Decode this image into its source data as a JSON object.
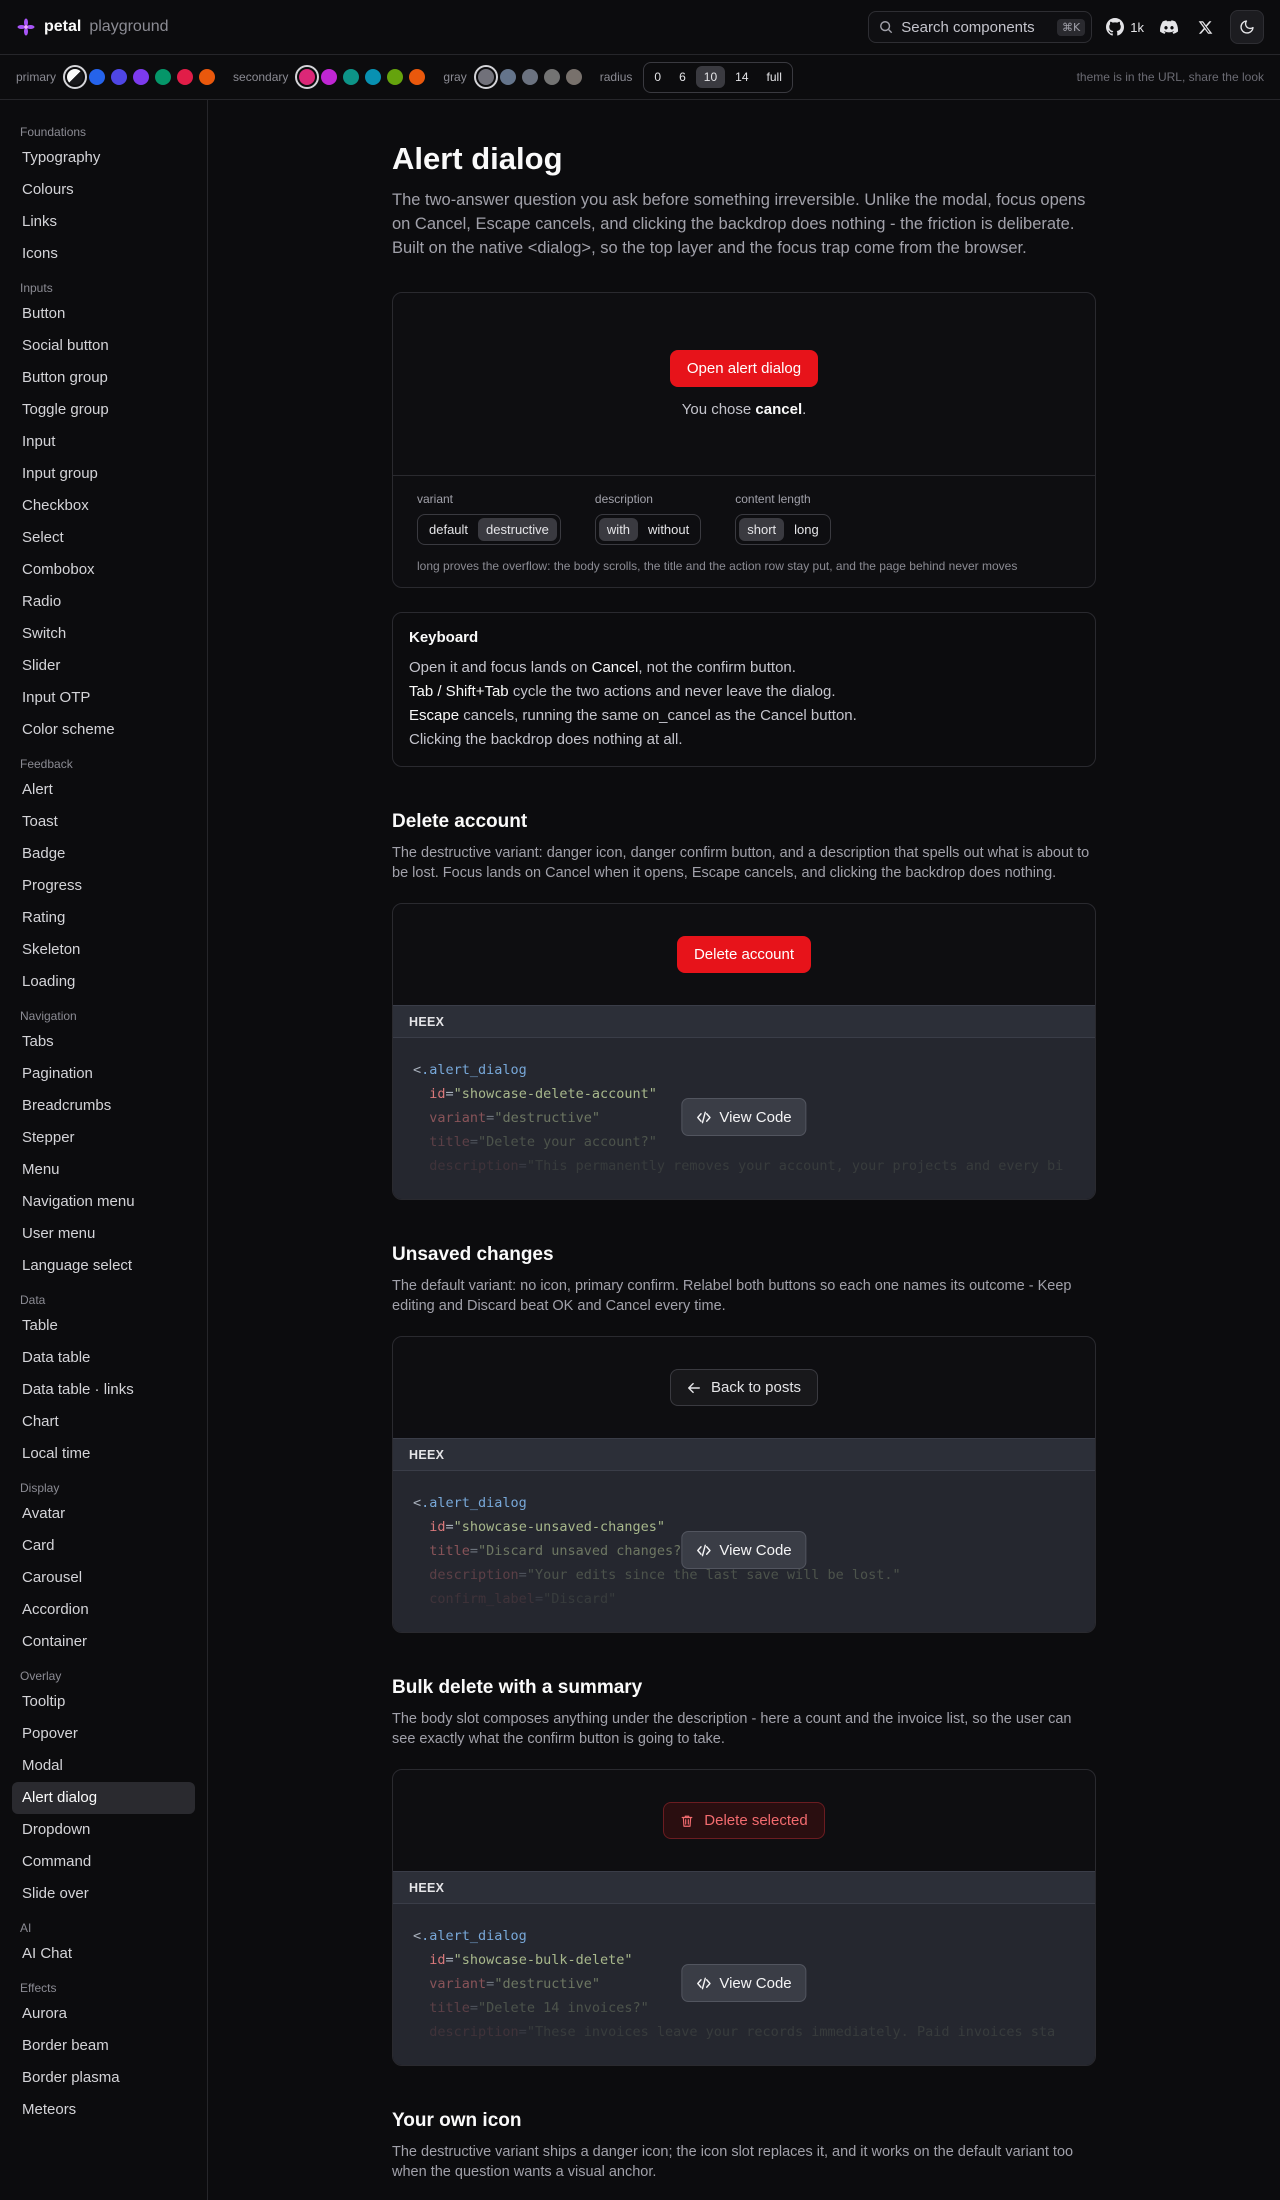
{
  "header": {
    "brand": "petal",
    "brand_sub": "playground",
    "search_placeholder": "Search components",
    "search_shortcut": "⌘K",
    "github_count": "1k"
  },
  "themebar": {
    "primary_label": "primary",
    "secondary_label": "secondary",
    "gray_label": "gray",
    "radius_label": "radius",
    "primary_colors": [
      "#e4e4e7",
      "#2563eb",
      "#4f46e5",
      "#7c3aed",
      "#059669",
      "#e11d48",
      "#ea580c"
    ],
    "secondary_colors": [
      "#db2777",
      "#c026d3",
      "#0d9488",
      "#0891b2",
      "#65a30d",
      "#ea580c"
    ],
    "gray_colors": [
      "#71717a",
      "#64748b",
      "#6b7280",
      "#737373",
      "#78716c"
    ],
    "radius_options": [
      "0",
      "6",
      "10",
      "14",
      "full"
    ],
    "radius_selected": "10",
    "note": "theme is in the URL, share the look"
  },
  "sidebar": {
    "sections": [
      {
        "title": "Foundations",
        "items": [
          "Typography",
          "Colours",
          "Links",
          "Icons"
        ]
      },
      {
        "title": "Inputs",
        "items": [
          "Button",
          "Social button",
          "Button group",
          "Toggle group",
          "Input",
          "Input group",
          "Checkbox",
          "Select",
          "Combobox",
          "Radio",
          "Switch",
          "Slider",
          "Input OTP",
          "Color scheme"
        ]
      },
      {
        "title": "Feedback",
        "items": [
          "Alert",
          "Toast",
          "Badge",
          "Progress",
          "Rating",
          "Skeleton",
          "Loading"
        ]
      },
      {
        "title": "Navigation",
        "items": [
          "Tabs",
          "Pagination",
          "Breadcrumbs",
          "Stepper",
          "Menu",
          "Navigation menu",
          "User menu",
          "Language select"
        ]
      },
      {
        "title": "Data",
        "items": [
          "Table",
          "Data table",
          "Data table · links",
          "Chart",
          "Local time"
        ]
      },
      {
        "title": "Display",
        "items": [
          "Avatar",
          "Card",
          "Carousel",
          "Accordion",
          "Container"
        ]
      },
      {
        "title": "Overlay",
        "items": [
          "Tooltip",
          "Popover",
          "Modal",
          "Alert dialog",
          "Dropdown",
          "Command",
          "Slide over"
        ]
      },
      {
        "title": "AI",
        "items": [
          "AI Chat"
        ]
      },
      {
        "title": "Effects",
        "items": [
          "Aurora",
          "Border beam",
          "Border plasma",
          "Meteors"
        ]
      }
    ],
    "active": "Alert dialog"
  },
  "page": {
    "title": "Alert dialog",
    "lead": "The two-answer question you ask before something irreversible. Unlike the modal, focus opens on Cancel, Escape cancels, and clicking the backdrop does nothing - the friction is deliberate. Built on the native <dialog>, so the top layer and the focus trap come from the browser.",
    "demo": {
      "open_button": "Open alert dialog",
      "chose_prefix": "You chose ",
      "chose_value": "cancel",
      "chose_suffix": ".",
      "controls": [
        {
          "label": "variant",
          "options": [
            "default",
            "destructive"
          ],
          "selected": "destructive"
        },
        {
          "label": "description",
          "options": [
            "with",
            "without"
          ],
          "selected": "with"
        },
        {
          "label": "content length",
          "options": [
            "short",
            "long"
          ],
          "selected": "short"
        }
      ],
      "note": "long proves the overflow: the body scrolls, the title and the action row stay put, and the page behind never moves"
    },
    "keyboard": {
      "title": "Keyboard",
      "line1_a": "Open it and focus lands on ",
      "line1_b": "Cancel",
      "line1_c": ", not the confirm button.",
      "line2_a": "Tab / Shift+Tab",
      "line2_b": " cycle the two actions and never leave the dialog.",
      "line3_a": "Escape",
      "line3_b": " cancels, running the same on_cancel as the Cancel button.",
      "line4": "Clicking the backdrop does nothing at all."
    },
    "sections": [
      {
        "title": "Delete account",
        "desc": "The destructive variant: danger icon, danger confirm button, and a description that spells out what is about to be lost. Focus lands on Cancel when it opens, Escape cancels, and clicking the backdrop does nothing.",
        "button": "Delete account",
        "code_header": "HEEX",
        "code": {
          "tag": ".alert_dialog",
          "lines": [
            {
              "attr": "id",
              "value": "\"showcase-delete-account\""
            },
            {
              "attr": "variant",
              "value": "\"destructive\""
            },
            {
              "attr": "title",
              "value": "\"Delete your account?\""
            },
            {
              "attr": "description",
              "value": "\"This permanently removes your account, your projects and every bi"
            }
          ]
        },
        "view_code": "View Code"
      },
      {
        "title": "Unsaved changes",
        "desc": "The default variant: no icon, primary confirm. Relabel both buttons so each one names its outcome - Keep editing and Discard beat OK and Cancel every time.",
        "button": "Back to posts",
        "code_header": "HEEX",
        "code": {
          "tag": ".alert_dialog",
          "lines": [
            {
              "attr": "id",
              "value": "\"showcase-unsaved-changes\""
            },
            {
              "attr": "title",
              "value": "\"Discard unsaved changes?\""
            },
            {
              "attr": "description",
              "value": "\"Your edits since the last save will be lost.\""
            },
            {
              "attr": "confirm_label",
              "value": "\"Discard\""
            }
          ]
        },
        "view_code": "View Code"
      },
      {
        "title": "Bulk delete with a summary",
        "desc": "The body slot composes anything under the description - here a count and the invoice list, so the user can see exactly what the confirm button is going to take.",
        "button": "Delete selected",
        "code_header": "HEEX",
        "code": {
          "tag": ".alert_dialog",
          "lines": [
            {
              "attr": "id",
              "value": "\"showcase-bulk-delete\""
            },
            {
              "attr": "variant",
              "value": "\"destructive\""
            },
            {
              "attr": "title",
              "value": "\"Delete 14 invoices?\""
            },
            {
              "attr": "description",
              "value": "\"These invoices leave your records immediately. Paid invoices sta"
            }
          ]
        },
        "view_code": "View Code"
      }
    ],
    "tail": {
      "title": "Your own icon",
      "desc": "The destructive variant ships a danger icon; the icon slot replaces it, and it works on the default variant too when the question wants a visual anchor."
    }
  }
}
